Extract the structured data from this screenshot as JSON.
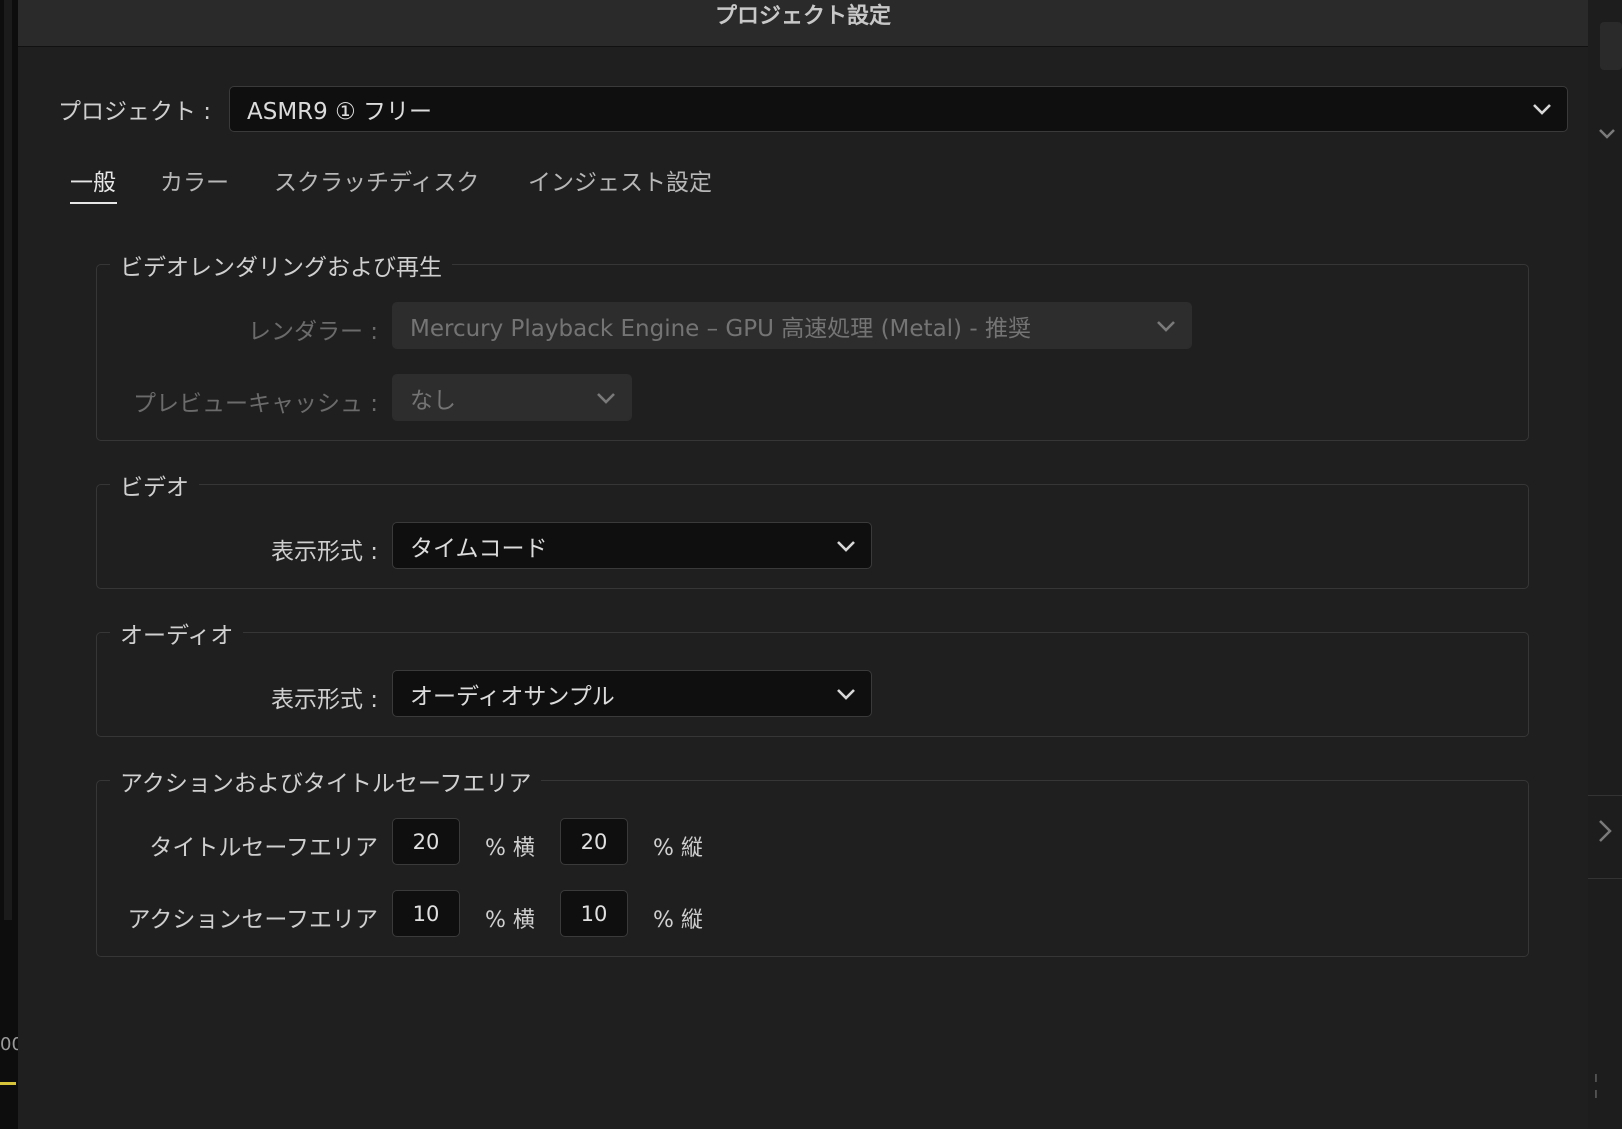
{
  "dialog": {
    "title": "プロジェクト設定"
  },
  "project": {
    "label": "プロジェクト :",
    "value": "ASMR9 ① フリー"
  },
  "tabs": [
    {
      "label": "一般",
      "active": true
    },
    {
      "label": "カラー",
      "active": false
    },
    {
      "label": "スクラッチディスク",
      "active": false
    },
    {
      "label": "インジェスト設定",
      "active": false
    }
  ],
  "rendering": {
    "title": "ビデオレンダリングおよび再生",
    "renderer_label": "レンダラー :",
    "renderer_value": "Mercury Playback Engine – GPU 高速処理 (Metal) - 推奨",
    "preview_cache_label": "プレビューキャッシュ :",
    "preview_cache_value": "なし"
  },
  "video": {
    "title": "ビデオ",
    "display_format_label": "表示形式 :",
    "display_format_value": "タイムコード"
  },
  "audio": {
    "title": "オーディオ",
    "display_format_label": "表示形式 :",
    "display_format_value": "オーディオサンプル"
  },
  "safe_areas": {
    "title": "アクションおよびタイトルセーフエリア",
    "title_safe_label": "タイトルセーフエリア",
    "title_safe_h": "20",
    "title_safe_v": "20",
    "action_safe_label": "アクションセーフエリア",
    "action_safe_h": "10",
    "action_safe_v": "10",
    "unit_h": "% 横",
    "unit_v": "% 縦"
  },
  "background": {
    "timecode_fragment": "00"
  },
  "colors": {
    "dialog_bg": "#1f1f1f",
    "field_bg": "#0f0f0f",
    "disabled_field_bg": "#2d2d2d",
    "text": "#cfcfcf",
    "dim_text": "#6b6b6b"
  }
}
